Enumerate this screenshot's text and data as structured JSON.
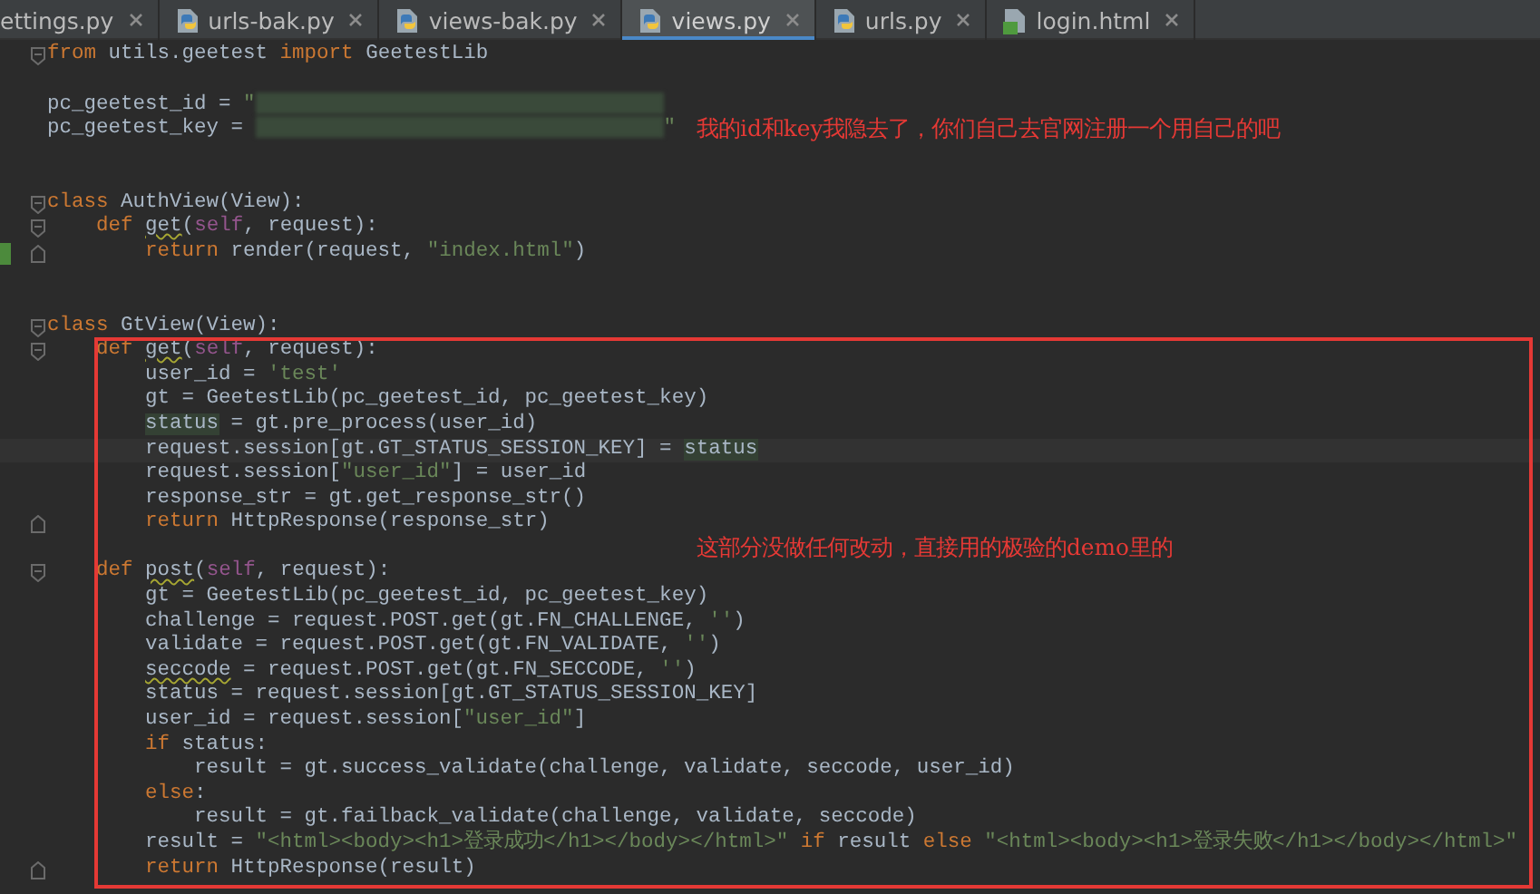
{
  "tabs": [
    {
      "label": "ettings.py",
      "selected": false
    },
    {
      "label": "urls-bak.py",
      "kind": "python",
      "selected": false
    },
    {
      "label": "views-bak.py",
      "kind": "python",
      "selected": false
    },
    {
      "label": "views.py",
      "kind": "python",
      "selected": true
    },
    {
      "label": "urls.py",
      "kind": "python",
      "selected": false
    },
    {
      "label": "login.html",
      "kind": "html",
      "selected": false
    }
  ],
  "blocks": [
    {
      "lines": [
        {
          "kind": "code",
          "fold_start": true,
          "tokens": [
            {
              "text": "from",
              "kind": "kw"
            },
            {
              "text": " utils.geetest ",
              "kind": "plain"
            },
            {
              "text": "import",
              "kind": "kw"
            },
            {
              "text": " GeetestLib",
              "kind": "plain"
            }
          ]
        },
        {
          "kind": "blank"
        },
        {
          "kind": "code",
          "tokens": [
            {
              "text": "pc_geetest_id = ",
              "kind": "plain"
            },
            {
              "text": "\"",
              "kind": "str"
            },
            {
              "kind": "redacted"
            }
          ]
        },
        {
          "kind": "code",
          "note": "我的id和key我隐去了，你们自己去官网注册一个用自己的吧",
          "tokens": [
            {
              "text": "pc_geetest_key = ",
              "kind": "plain"
            },
            {
              "kind": "redacted"
            },
            {
              "text": "\"",
              "kind": "str"
            }
          ]
        },
        {
          "kind": "blank"
        },
        {
          "kind": "blank"
        },
        {
          "kind": "code",
          "fold_start": true,
          "tokens": [
            {
              "text": "class",
              "kind": "kw"
            },
            {
              "text": " AuthView(View):",
              "kind": "plain"
            }
          ]
        },
        {
          "kind": "code",
          "fold_start": true,
          "tokens": [
            {
              "text": "    def ",
              "kind": "kw"
            },
            {
              "text": "get",
              "kind": "warn"
            },
            {
              "text": "(",
              "kind": "plain"
            },
            {
              "text": "self",
              "kind": "self"
            },
            {
              "text": ", request):",
              "kind": "plain"
            }
          ]
        },
        {
          "kind": "code",
          "fold_end": true,
          "changed": true,
          "tokens": [
            {
              "text": "        return",
              "kind": "kw"
            },
            {
              "text": " render(request, ",
              "kind": "plain"
            },
            {
              "text": "\"index.html\"",
              "kind": "str"
            },
            {
              "text": ")",
              "kind": "plain"
            }
          ]
        },
        {
          "kind": "blank"
        },
        {
          "kind": "blank"
        },
        {
          "kind": "code",
          "fold_start": true,
          "tokens": [
            {
              "text": "class",
              "kind": "kw"
            },
            {
              "text": " GtView(View):",
              "kind": "plain"
            }
          ]
        }
      ]
    },
    {
      "framed": true,
      "lines": [
        {
          "kind": "code",
          "fold_start": true,
          "tokens": [
            {
              "text": "    def ",
              "kind": "kw"
            },
            {
              "text": "get",
              "kind": "warn"
            },
            {
              "text": "(",
              "kind": "plain"
            },
            {
              "text": "self",
              "kind": "self"
            },
            {
              "text": ", request):",
              "kind": "plain"
            }
          ]
        },
        {
          "kind": "code",
          "tokens": [
            {
              "text": "        user_id = ",
              "kind": "plain"
            },
            {
              "text": "'test'",
              "kind": "str"
            }
          ]
        },
        {
          "kind": "code",
          "tokens": [
            {
              "text": "        gt = GeetestLib(pc_geetest_id, pc_geetest_key)",
              "kind": "plain"
            }
          ]
        },
        {
          "kind": "code",
          "tokens": [
            {
              "text": "        status",
              "kind": "hl"
            },
            {
              "text": " = gt.pre_process(user_id)",
              "kind": "plain"
            }
          ]
        },
        {
          "kind": "code",
          "current": true,
          "tokens": [
            {
              "text": "        request.session[gt.GT_STATUS_SESSION_KEY] = ",
              "kind": "plain"
            },
            {
              "text": "status",
              "kind": "hl"
            }
          ]
        },
        {
          "kind": "code",
          "tokens": [
            {
              "text": "        request.session[",
              "kind": "plain"
            },
            {
              "text": "\"user_id\"",
              "kind": "str"
            },
            {
              "text": "] = user_id",
              "kind": "plain"
            }
          ]
        },
        {
          "kind": "code",
          "tokens": [
            {
              "text": "        response_str = gt.get_response_str()",
              "kind": "plain"
            }
          ]
        },
        {
          "kind": "code",
          "fold_end": true,
          "tokens": [
            {
              "text": "        return",
              "kind": "kw"
            },
            {
              "text": " HttpResponse(response_str)",
              "kind": "plain"
            }
          ]
        },
        {
          "kind": "blank",
          "note": "这部分没做任何改动，直接用的极验的demo里的"
        },
        {
          "kind": "code",
          "fold_start": true,
          "tokens": [
            {
              "text": "    def ",
              "kind": "kw"
            },
            {
              "text": "post",
              "kind": "warn"
            },
            {
              "text": "(",
              "kind": "plain"
            },
            {
              "text": "self",
              "kind": "self"
            },
            {
              "text": ", request):",
              "kind": "plain"
            }
          ]
        },
        {
          "kind": "code",
          "tokens": [
            {
              "text": "        gt = GeetestLib(pc_geetest_id, pc_geetest_key)",
              "kind": "plain"
            }
          ]
        },
        {
          "kind": "code",
          "tokens": [
            {
              "text": "        challenge = request.POST.get(gt.FN_CHALLENGE, ",
              "kind": "plain"
            },
            {
              "text": "''",
              "kind": "str"
            },
            {
              "text": ")",
              "kind": "plain"
            }
          ]
        },
        {
          "kind": "code",
          "tokens": [
            {
              "text": "        validate = request.POST.get(gt.FN_VALIDATE, ",
              "kind": "plain"
            },
            {
              "text": "''",
              "kind": "str"
            },
            {
              "text": ")",
              "kind": "plain"
            }
          ]
        },
        {
          "kind": "code",
          "tokens": [
            {
              "text": "        seccode",
              "kind": "warn"
            },
            {
              "text": " = request.POST.get(gt.FN_SECCODE, ",
              "kind": "plain"
            },
            {
              "text": "''",
              "kind": "str"
            },
            {
              "text": ")",
              "kind": "plain"
            }
          ]
        },
        {
          "kind": "code",
          "tokens": [
            {
              "text": "        status = request.session[gt.GT_STATUS_SESSION_KEY]",
              "kind": "plain"
            }
          ]
        },
        {
          "kind": "code",
          "tokens": [
            {
              "text": "        user_id = request.session[",
              "kind": "plain"
            },
            {
              "text": "\"user_id\"",
              "kind": "str"
            },
            {
              "text": "]",
              "kind": "plain"
            }
          ]
        },
        {
          "kind": "code",
          "tokens": [
            {
              "text": "        if",
              "kind": "kw"
            },
            {
              "text": " status:",
              "kind": "plain"
            }
          ]
        },
        {
          "kind": "code",
          "tokens": [
            {
              "text": "            result = gt.success_validate(challenge, validate, seccode, user_id)",
              "kind": "plain"
            }
          ]
        },
        {
          "kind": "code",
          "tokens": [
            {
              "text": "        else",
              "kind": "kw"
            },
            {
              "text": ":",
              "kind": "plain"
            }
          ]
        },
        {
          "kind": "code",
          "tokens": [
            {
              "text": "            result = gt.failback_validate(challenge, validate, seccode)",
              "kind": "plain"
            }
          ]
        },
        {
          "kind": "code",
          "tokens": [
            {
              "text": "        result = ",
              "kind": "plain"
            },
            {
              "text": "\"<html><body><h1>登录成功</h1></body></html>\"",
              "kind": "str"
            },
            {
              "text": " if",
              "kind": "kw"
            },
            {
              "text": " result ",
              "kind": "plain"
            },
            {
              "text": "else",
              "kind": "kw"
            },
            {
              "text": " \"<html><body><h1>登录失败</h1></body></html>\"",
              "kind": "str"
            }
          ]
        },
        {
          "kind": "code",
          "fold_end": true,
          "tokens": [
            {
              "text": "        return",
              "kind": "kw"
            },
            {
              "text": " HttpResponse(result)",
              "kind": "plain"
            }
          ]
        }
      ]
    }
  ]
}
